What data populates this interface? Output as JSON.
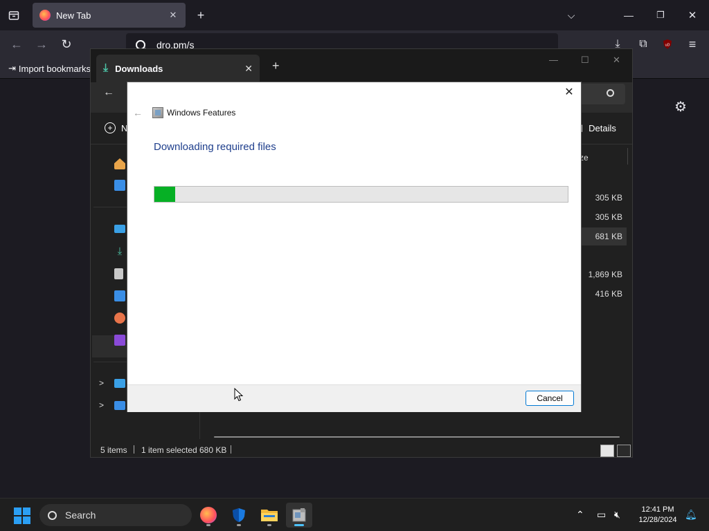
{
  "browser": {
    "tab_title": "New Tab",
    "url": "dro.pm/s",
    "bookmark_import_label": "Import bookmarks"
  },
  "explorer": {
    "tab_title": "Downloads",
    "new_label": "N",
    "details_label": "Details",
    "size_header": "ze",
    "sizes": [
      "305 KB",
      "305 KB",
      "681 KB",
      "1,869 KB",
      "416 KB"
    ],
    "status": {
      "items": "5 items",
      "selected": "1 item selected",
      "size": "680 KB"
    }
  },
  "dialog": {
    "app_title": "Windows Features",
    "heading": "Downloading required files",
    "progress_fraction": 0.05,
    "cancel_label": "Cancel"
  },
  "taskbar": {
    "search_placeholder": "Search",
    "time": "12:41 PM",
    "date": "12/28/2024"
  },
  "colors": {
    "progress_fill": "#06b025",
    "dialog_heading": "#1e3e8c",
    "accent": "#0078d4"
  }
}
